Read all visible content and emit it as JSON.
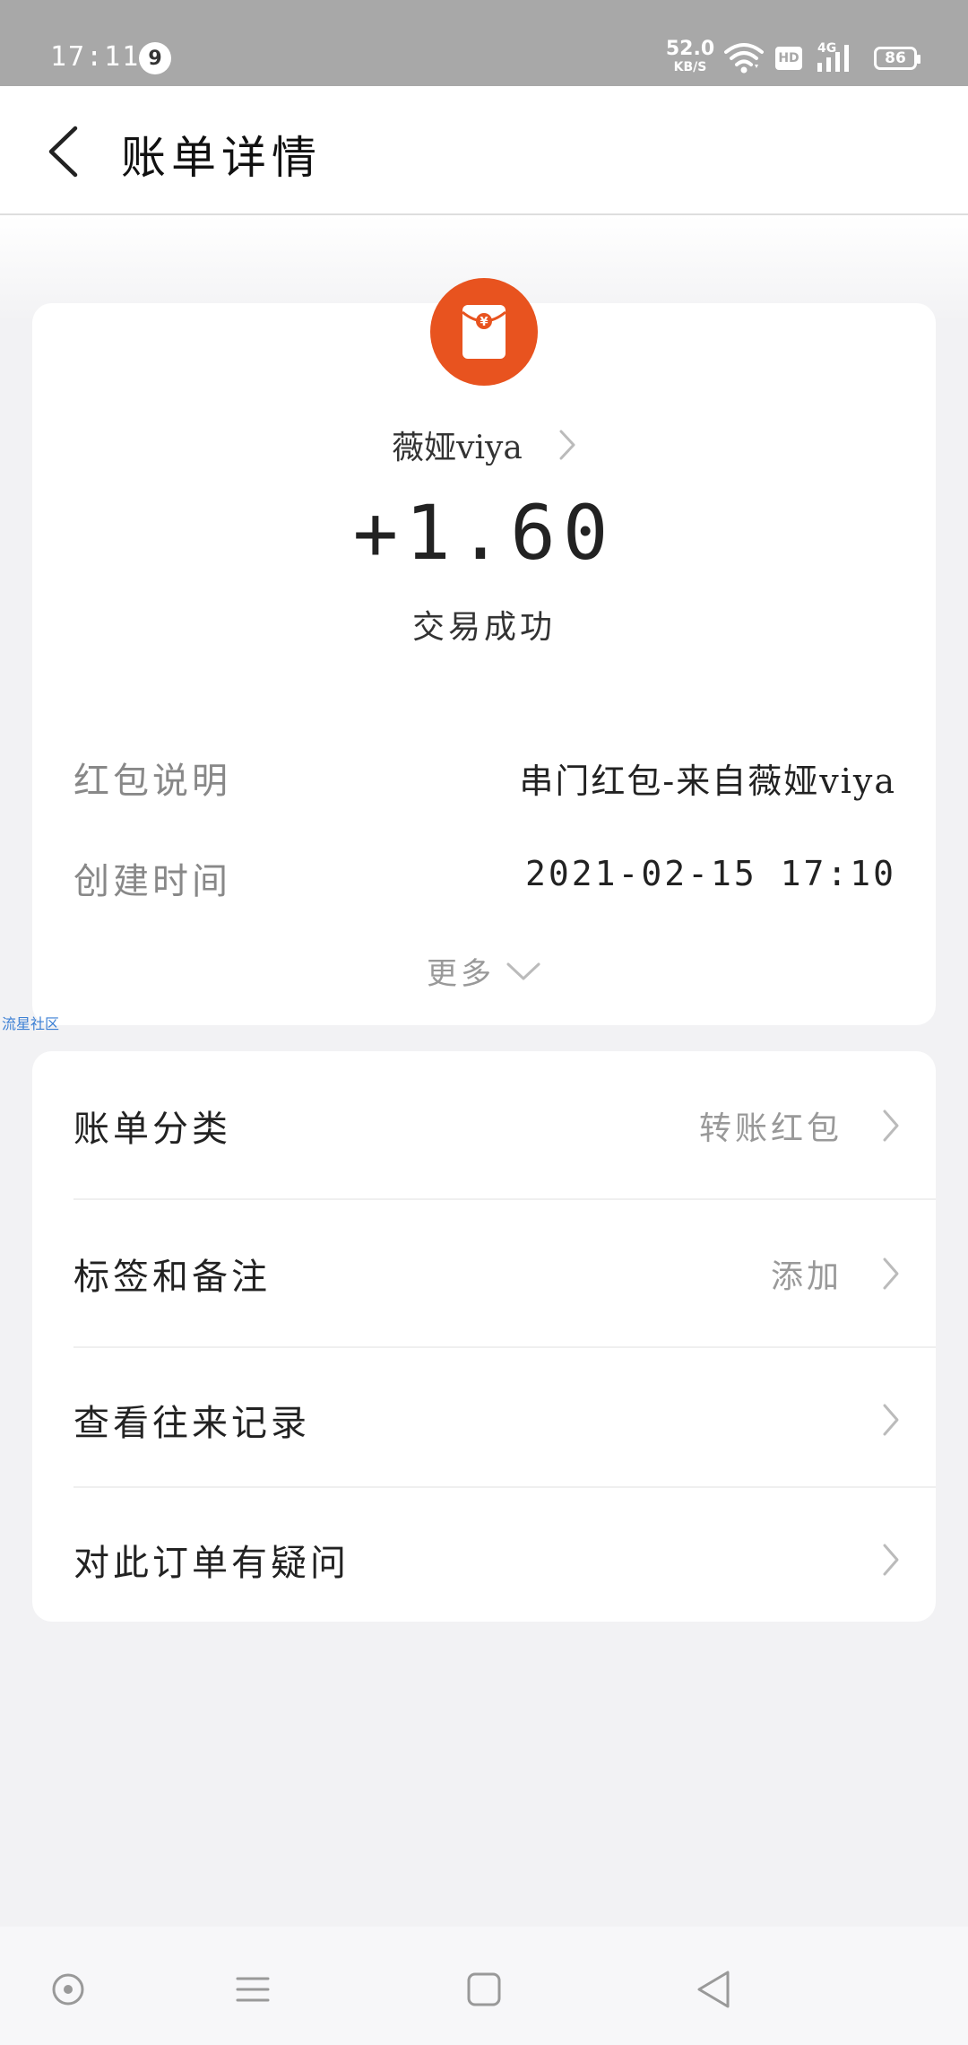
{
  "status_bar": {
    "time": "17:11",
    "notification_count": "9",
    "net_speed": "52.0",
    "net_unit": "KB/S",
    "hd_label": "HD",
    "signal_label": "4G",
    "battery": "86"
  },
  "header": {
    "title": "账单详情"
  },
  "summary": {
    "sender": "薇娅viya",
    "amount": "+1.60",
    "status": "交易成功",
    "avatar_icon": "red-packet-icon",
    "avatar_color": "#e8531f"
  },
  "details": {
    "items": [
      {
        "label": "红包说明",
        "value": "串门红包-来自薇娅viya"
      },
      {
        "label": "创建时间",
        "value": "2021-02-15 17:10"
      }
    ],
    "more_label": "更多"
  },
  "watermark": "流星社区",
  "actions": {
    "items": [
      {
        "label": "账单分类",
        "value": "转账红包"
      },
      {
        "label": "标签和备注",
        "value": "添加"
      },
      {
        "label": "查看往来记录",
        "value": ""
      },
      {
        "label": "对此订单有疑问",
        "value": ""
      }
    ]
  }
}
